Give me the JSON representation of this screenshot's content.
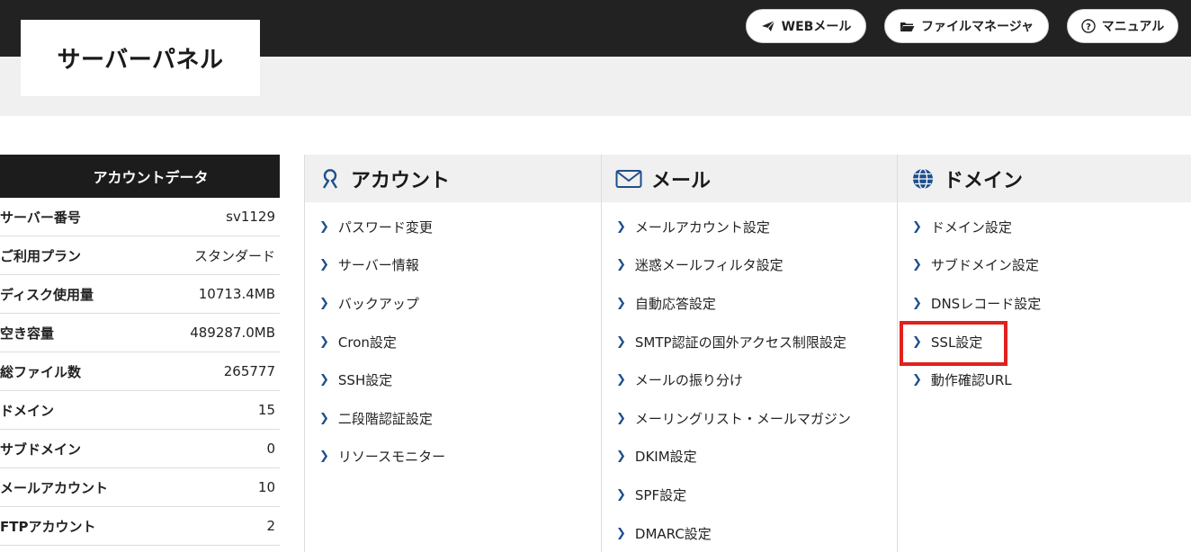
{
  "header": {
    "title": "サーバーパネル",
    "buttons": [
      {
        "label": "WEBメール",
        "icon": "paper-plane-icon"
      },
      {
        "label": "ファイルマネージャ",
        "icon": "folder-icon"
      },
      {
        "label": "マニュアル",
        "icon": "question-circle-icon"
      }
    ]
  },
  "account_data": {
    "heading": "アカウントデータ",
    "rows": [
      {
        "key": "サーバー番号",
        "value": "sv1129"
      },
      {
        "key": "ご利用プラン",
        "value": "スタンダード"
      },
      {
        "key": "ディスク使用量",
        "value": "10713.4MB"
      },
      {
        "key": "空き容量",
        "value": "489287.0MB"
      },
      {
        "key": "総ファイル数",
        "value": "265777"
      },
      {
        "key": "ドメイン",
        "value": "15"
      },
      {
        "key": "サブドメイン",
        "value": "0"
      },
      {
        "key": "メールアカウント",
        "value": "10"
      },
      {
        "key": "FTPアカウント",
        "value": "2"
      }
    ]
  },
  "menus": {
    "account": {
      "title": "アカウント",
      "icon": "user-icon",
      "items": [
        "パスワード変更",
        "サーバー情報",
        "バックアップ",
        "Cron設定",
        "SSH設定",
        "二段階認証設定",
        "リソースモニター"
      ]
    },
    "mail": {
      "title": "メール",
      "icon": "envelope-icon",
      "items": [
        "メールアカウント設定",
        "迷惑メールフィルタ設定",
        "自動応答設定",
        "SMTP認証の国外アクセス制限設定",
        "メールの振り分け",
        "メーリングリスト・メールマガジン",
        "DKIM設定",
        "SPF設定",
        "DMARC設定"
      ]
    },
    "domain": {
      "title": "ドメイン",
      "icon": "globe-icon",
      "items": [
        "ドメイン設定",
        "サブドメイン設定",
        "DNSレコード設定",
        "SSL設定",
        "動作確認URL"
      ]
    }
  },
  "colors": {
    "topbar": "#222222",
    "chevron": "#1f4e8c",
    "highlight": "#e0211d"
  }
}
